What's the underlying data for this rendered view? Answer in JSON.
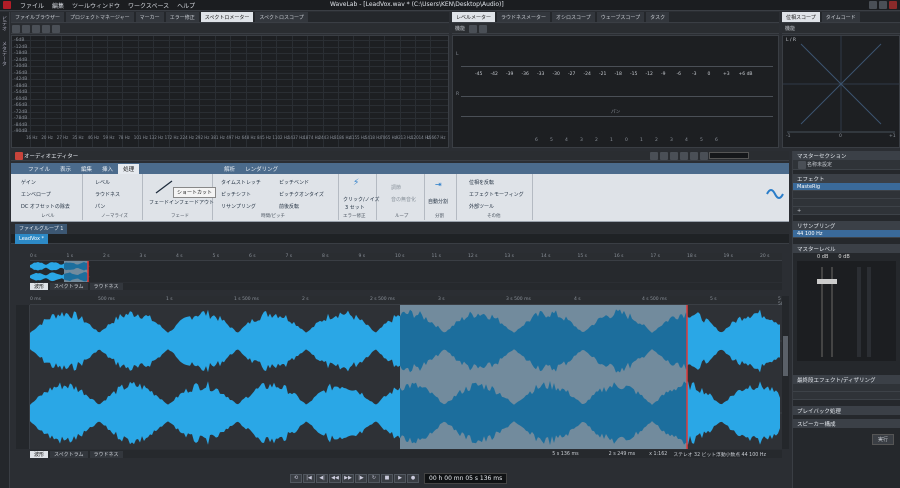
{
  "title_bar": {
    "menus": [
      "ファイル",
      "編集",
      "ツールウィンドウ",
      "ワークスペース",
      "ヘルプ"
    ],
    "window_title": "WaveLab - [LeadVox.wav * (C:\\Users\\KEN\\Desktop\\Audio)]"
  },
  "left_tabs": [
    "ファイルブラウザー",
    "プロジェクトマネージャー",
    "マーカー",
    "エラー修正",
    "スペクトロメーター",
    "スペクトロスコープ"
  ],
  "center_tabs": [
    "レベルメーター",
    "ラウドネスメーター",
    "オシロスコープ",
    "ウェーブスコープ",
    "タスク"
  ],
  "right_tabs": [
    "位相スコープ",
    "タイムコード"
  ],
  "left_side_labels": [
    "ビデオ",
    "メタデータ"
  ],
  "spectrum": {
    "db_labels": [
      "-6dB",
      "-12dB",
      "-18dB",
      "-24dB",
      "-30dB",
      "-36dB",
      "-42dB",
      "-48dB",
      "-54dB",
      "-60dB",
      "-66dB",
      "-72dB",
      "-78dB",
      "-84dB",
      "-90dB"
    ],
    "freq_labels": [
      "16 Hz",
      "20 Hz",
      "27 Hz",
      "35 Hz",
      "46 Hz",
      "59 Hz",
      "78 Hz",
      "101 Hz",
      "132 Hz",
      "172 Hz",
      "224 Hz",
      "292 Hz",
      "381 Hz",
      "497 Hz",
      "648 Hz",
      "845 Hz",
      "1102 Hz",
      "1437 Hz",
      "1874 Hz",
      "2443 Hz",
      "3186 Hz",
      "4155 Hz",
      "5418 Hz",
      "7065 Hz",
      "9213 Hz",
      "12014 Hz",
      "15667 Hz"
    ]
  },
  "level_meter": {
    "label": "機能",
    "scale": [
      "-45",
      "-42",
      "-39",
      "-36",
      "-33",
      "-30",
      "-27",
      "-24",
      "-21",
      "-18",
      "-15",
      "-12",
      "-9",
      "-6",
      "-3",
      "0",
      "+3",
      "+6 dB"
    ],
    "pan_label": "パン",
    "pan_scale": [
      "6",
      "5",
      "4",
      "3",
      "2",
      "1",
      "0",
      "1",
      "2",
      "3",
      "4",
      "5",
      "6"
    ],
    "ch_l": "L",
    "ch_r": "R"
  },
  "phase_scope": {
    "label": "機能",
    "lr": "L / R",
    "scale": [
      "-1",
      "0",
      "+1"
    ]
  },
  "editor": {
    "title": "オーディオエディター",
    "ribbon_tabs": [
      "ファイル",
      "表示",
      "編集",
      "挿入",
      "処理",
      "解析",
      "レンダリング"
    ],
    "active_tab": "処理",
    "tooltip": "ショートカット"
  },
  "ribbon": {
    "g1": {
      "items": [
        "ゲイン",
        "エンベロープ",
        "DC オフセットの除去"
      ],
      "cap": "レベル"
    },
    "g2": {
      "items": [
        "レベル",
        "ラウドネス",
        "パン"
      ],
      "cap": "ノーマライズ"
    },
    "g3": {
      "items": [
        "フェードイン",
        "フェードアウト"
      ],
      "cap": "フェード"
    },
    "g4": {
      "items": [
        "タイムストレッチ",
        "ピッチシフト",
        "リサンプリング",
        "ピッチベンド",
        "ピッチクオンタイズ",
        "前後反転"
      ],
      "cap": "時間/ピッチ"
    },
    "g5": {
      "items": [
        "クリック/ノイズ",
        "3 セット"
      ],
      "cap": "エラー修正"
    },
    "g6": {
      "items": [
        "調節",
        "音の無音化"
      ],
      "cap": "ループ"
    },
    "g7": {
      "items": [
        "自動分割"
      ],
      "cap": "分割"
    },
    "g8": {
      "items": [
        "位相を反転",
        "エフェクトモーフィング",
        "外部ツール"
      ],
      "cap": "その他"
    }
  },
  "file_group": {
    "tab": "ファイルグループ 1",
    "file_tab": "LeadVox *"
  },
  "overview_ruler": [
    "0 s",
    "1 s",
    "2 s",
    "3 s",
    "4 s",
    "5 s",
    "6 s",
    "7 s",
    "8 s",
    "9 s",
    "10 s",
    "11 s",
    "12 s",
    "13 s",
    "14 s",
    "15 s",
    "16 s",
    "17 s",
    "18 s",
    "19 s",
    "20 s"
  ],
  "overview_bottom_tabs": [
    "波形",
    "スペクトラム",
    "ラウドネス"
  ],
  "main_ruler": [
    "0 ms",
    "500 ms",
    "1 s",
    "1 s 500 ms",
    "2 s",
    "2 s 500 ms",
    "3 s",
    "3 s 500 ms",
    "4 s",
    "4 s 500 ms",
    "5 s",
    "5 s 500 ms"
  ],
  "main_bottom_tabs": [
    "波形",
    "スペクトラム",
    "ラウドネス"
  ],
  "status": {
    "pos": "5 s 136 ms",
    "sel": "2 s 249 ms",
    "zoom": "x 1:162",
    "format": "ステレオ 32 ビット浮動小数点 44 100 Hz"
  },
  "master": {
    "header": "マスターセクション",
    "effects_header": "エフェクト",
    "preset": "名称未設定",
    "plugins": [
      "MasteRig",
      "",
      ""
    ],
    "resampling_header": "リサンプリング",
    "rate": "44 100 Hz",
    "level_header": "マスターレベル",
    "level_vals": [
      "0 dB",
      "0 dB"
    ],
    "final_header": "最終段エフェクト/ディザリング",
    "playback_header": "プレイバック処理",
    "speaker_header": "スピーカー構成",
    "render": "実行"
  },
  "transport": {
    "time": "00 h 00 mn 05 s 136 ms"
  },
  "colors": {
    "wave": "#2aa7e6",
    "selection": "#c6dbe5",
    "cursor": "#e03a3a",
    "ribbon_blue": "#4b6b8c"
  }
}
